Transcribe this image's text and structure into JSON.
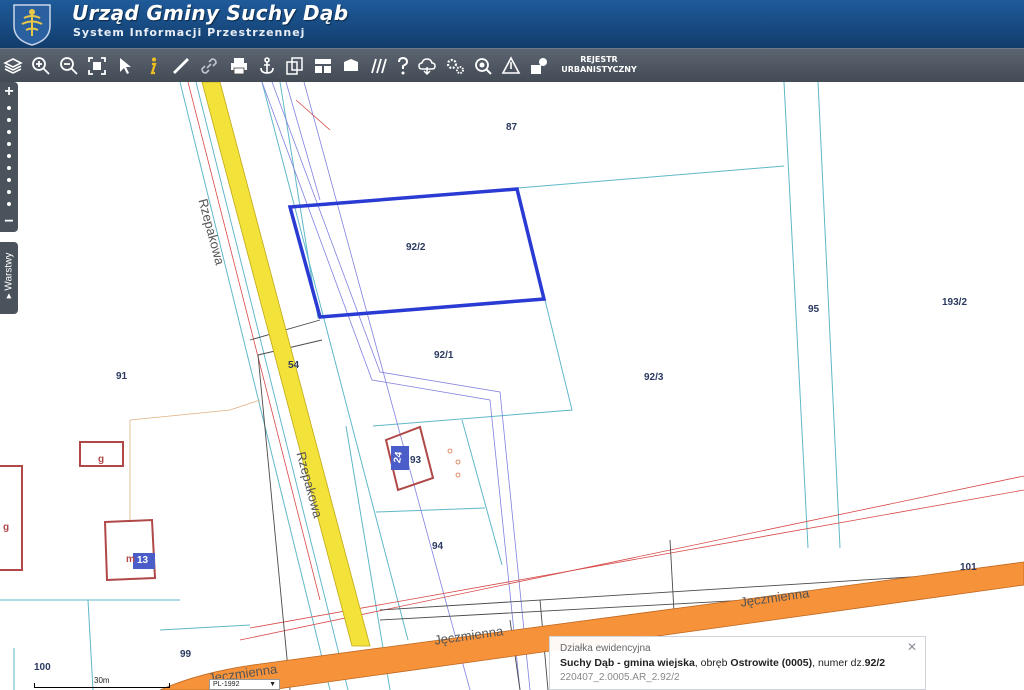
{
  "header": {
    "title": "Urząd Gminy Suchy Dąb",
    "subtitle": "System Informacji Przestrzennej"
  },
  "toolbar": {
    "icons": [
      "layers-icon",
      "zoom-in-icon",
      "zoom-out-icon",
      "zoom-extent-icon",
      "pointer-icon",
      "info-icon",
      "measure-icon",
      "link-icon",
      "print-icon",
      "anchor-icon",
      "copy-icon",
      "layout-icon",
      "shape-icon",
      "hatch-icon",
      "help-icon",
      "cloud-icon",
      "settings-icon",
      "search-icon",
      "warning-icon",
      "parcel-icon"
    ],
    "registry_label_line1": "REJESTR",
    "registry_label_line2": "URBANISTYCZNY"
  },
  "map": {
    "parcels": [
      "87",
      "92/2",
      "92/1",
      "92/3",
      "95",
      "193/2",
      "91",
      "54",
      "93",
      "94",
      "99",
      "100",
      "101"
    ],
    "building_labels": [
      "g",
      "g",
      "m"
    ],
    "house_numbers": [
      "24",
      "13"
    ],
    "streets": [
      "Rzepakowa",
      "Rzepakowa",
      "Jęczmienna",
      "Jęczmienna",
      "Jęczmienna"
    ]
  },
  "zoombar": {
    "plus": "+",
    "minus": "−"
  },
  "layers_tab": {
    "label": "▸ Warstwy"
  },
  "popup": {
    "title": "Działka ewidencyjna",
    "commune": "Suchy Dąb - gmina wiejska",
    "sep1": ", obręb ",
    "precinct": "Ostrowite (0005)",
    "sep2": ", numer dz.",
    "parcel_number": "92/2",
    "identifier": "220407_2.0005.AR_2.92/2",
    "close": "✕"
  },
  "scale": {
    "label": "30m"
  },
  "projection": {
    "value": "PL-1992"
  },
  "colors": {
    "selection": "#2a3bd4",
    "parcel_line": "#5fb8c8",
    "building": "#b04848",
    "street_yellow": "#f2e23a",
    "street_orange": "#f5923a"
  }
}
